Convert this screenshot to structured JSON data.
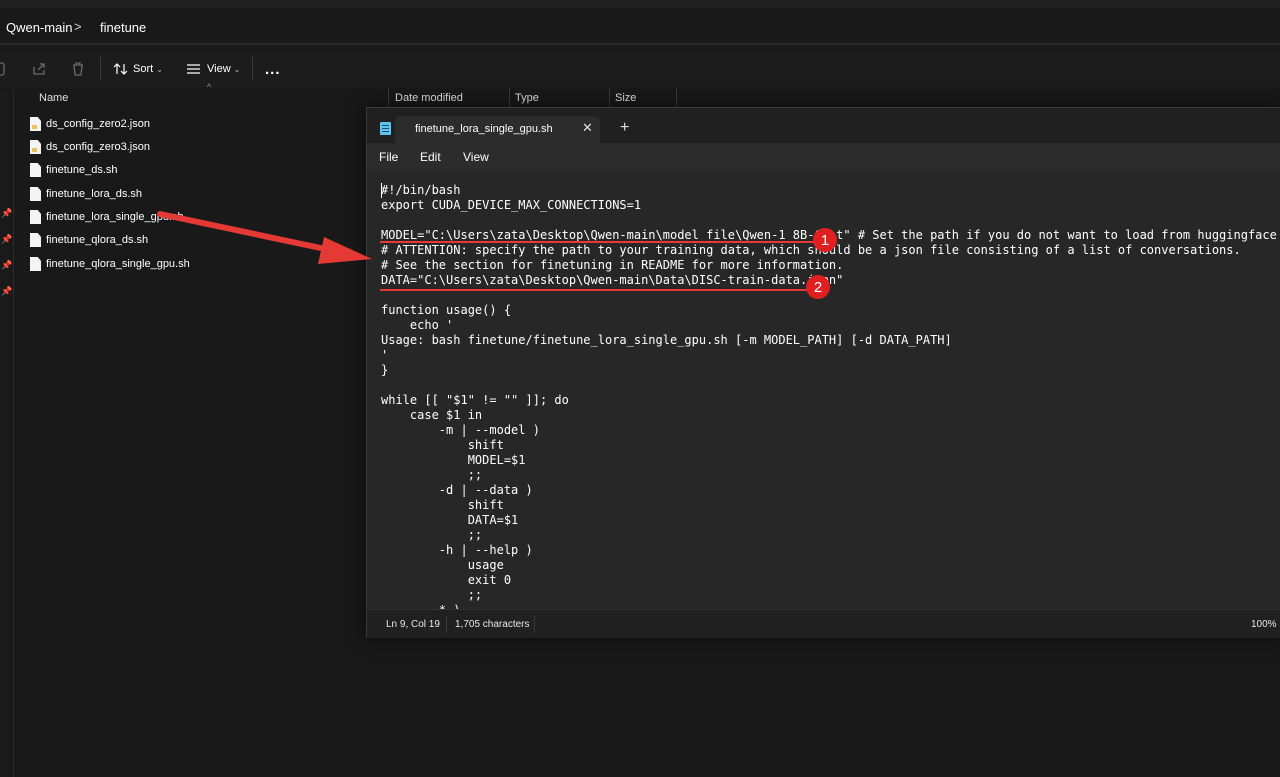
{
  "explorer": {
    "breadcrumb": [
      "Qwen-main",
      "finetune"
    ],
    "breadcrumb_separator": ">",
    "commands": {
      "sort_label": "Sort",
      "view_label": "View",
      "more_label": "..."
    },
    "columns": {
      "name": "Name",
      "date_modified": "Date modified",
      "type": "Type",
      "size": "Size"
    },
    "files": [
      {
        "name": "ds_config_zero2.json",
        "icon": "json-file-icon"
      },
      {
        "name": "ds_config_zero3.json",
        "icon": "json-file-icon"
      },
      {
        "name": "finetune_ds.sh",
        "icon": "file-icon"
      },
      {
        "name": "finetune_lora_ds.sh",
        "icon": "file-icon"
      },
      {
        "name": "finetune_lora_single_gpu.sh",
        "icon": "file-icon"
      },
      {
        "name": "finetune_qlora_ds.sh",
        "icon": "file-icon"
      },
      {
        "name": "finetune_qlora_single_gpu.sh",
        "icon": "file-icon"
      }
    ]
  },
  "notepad": {
    "tab_title": "finetune_lora_single_gpu.sh",
    "tab_close": "✕",
    "tab_new": "+",
    "menu": {
      "file": "File",
      "edit": "Edit",
      "view": "View"
    },
    "lines": [
      "#!/bin/bash",
      "export CUDA_DEVICE_MAX_CONNECTIONS=1",
      "",
      "MODEL=\"C:\\Users\\zata\\Desktop\\Qwen-main\\model file\\Qwen-1_8B-Chat\" # Set the path if you do not want to load from huggingface directly",
      "# ATTENTION: specify the path to your training data, which should be a json file consisting of a list of conversations.",
      "# See the section for finetuning in README for more information.",
      "DATA=\"C:\\Users\\zata\\Desktop\\Qwen-main\\Data\\DISC-train-data.json\"",
      "",
      "function usage() {",
      "    echo '",
      "Usage: bash finetune/finetune_lora_single_gpu.sh [-m MODEL_PATH] [-d DATA_PATH]",
      "'",
      "}",
      "",
      "while [[ \"$1\" != \"\" ]]; do",
      "    case $1 in",
      "        -m | --model )",
      "            shift",
      "            MODEL=$1",
      "            ;;",
      "        -d | --data )",
      "            shift",
      "            DATA=$1",
      "            ;;",
      "        -h | --help )",
      "            usage",
      "            exit 0",
      "            ;;",
      "        * )"
    ],
    "status": {
      "position": "Ln 9, Col 19",
      "characters": "1,705 characters",
      "zoom": "100%"
    }
  },
  "annotations": {
    "badge_1": "1",
    "badge_2": "2",
    "color": "#e02020"
  },
  "colors": {
    "background": "#191919",
    "editor_background": "#272727",
    "menubar_background": "#2c2c2c",
    "accent_red": "#e53935",
    "notepad_icon": "#5cc6f0"
  }
}
